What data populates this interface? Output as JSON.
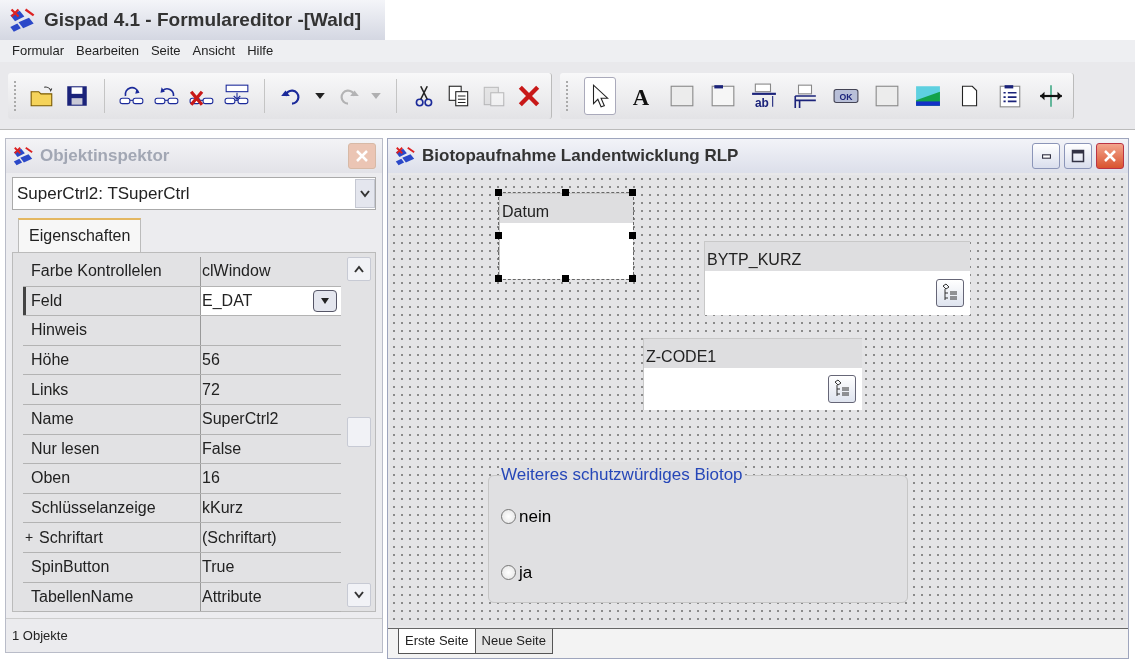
{
  "window": {
    "title": "Gispad 4.1 - Formulareditor -[Wald]"
  },
  "menu": [
    "Formular",
    "Bearbeiten",
    "Seite",
    "Ansicht",
    "Hilfe"
  ],
  "toolbar": [
    [
      {
        "kind": "open",
        "disabled": false
      },
      {
        "kind": "save",
        "disabled": false
      }
    ],
    [
      {
        "kind": "link-in",
        "disabled": false
      },
      {
        "kind": "link-out",
        "disabled": false
      },
      {
        "kind": "link-delete",
        "disabled": false
      },
      {
        "kind": "table-layout",
        "disabled": false
      }
    ],
    [
      {
        "kind": "undo",
        "disabled": false
      },
      {
        "kind": "dropdown",
        "disabled": false
      },
      {
        "kind": "redo",
        "disabled": true
      },
      {
        "kind": "dropdown",
        "disabled": true
      }
    ],
    [
      {
        "kind": "cut",
        "disabled": false
      },
      {
        "kind": "copy",
        "disabled": false
      },
      {
        "kind": "paste",
        "disabled": true
      },
      {
        "kind": "delete",
        "disabled": false
      }
    ]
  ],
  "tools": [
    {
      "kind": "pointer",
      "selected": true
    },
    {
      "kind": "text",
      "glyph": "A",
      "selected": false
    },
    {
      "kind": "blank",
      "selected": false
    },
    {
      "kind": "panel",
      "selected": false
    },
    {
      "kind": "edit",
      "glyph": "ab",
      "selected": false
    },
    {
      "kind": "grid",
      "selected": false
    },
    {
      "kind": "button",
      "glyph": "OK",
      "selected": false
    },
    {
      "kind": "blank",
      "selected": false
    },
    {
      "kind": "image",
      "selected": false
    },
    {
      "kind": "page",
      "selected": false
    },
    {
      "kind": "list",
      "selected": false
    },
    {
      "kind": "splitter",
      "selected": false
    }
  ],
  "inspector": {
    "title": "Objektinspektor",
    "object_select": "SuperCtrl2: TSuperCtrl",
    "tabs": [
      {
        "label": "Eigenschaften",
        "selected": true
      }
    ],
    "properties": [
      {
        "name": "Farbe Kontrollelen",
        "value": "clWindow",
        "selected": false
      },
      {
        "name": "Feld",
        "value": "E_DAT",
        "selected": true
      },
      {
        "name": "Hinweis",
        "selected": false
      },
      {
        "name": "Höhe",
        "value": "56",
        "selected": false
      },
      {
        "name": "Links",
        "value": "72",
        "selected": false
      },
      {
        "name": "Name",
        "value": "SuperCtrl2",
        "selected": false
      },
      {
        "name": "Nur lesen",
        "value": "False",
        "selected": false
      },
      {
        "name": "Oben",
        "value": "16",
        "selected": false
      },
      {
        "name": "Schlüsselanzeige",
        "value": "kKurz",
        "selected": false
      },
      {
        "name": "Schriftart",
        "expander": "+",
        "value": "(Schriftart)",
        "selected": false
      },
      {
        "name": "SpinButton",
        "value": "True",
        "selected": false
      },
      {
        "name": "TabellenName",
        "value": "Attribute",
        "selected": false
      }
    ],
    "status": "1 Objekte"
  },
  "form_window": {
    "title": "Biotopaufnahme Landentwicklung RLP",
    "controls": [
      {
        "kind": "field",
        "label": "Datum",
        "selected": true,
        "lookup_button": false
      },
      {
        "kind": "field",
        "label": "BYTP_KURZ",
        "selected": false,
        "lookup_button": true
      },
      {
        "kind": "field",
        "label": "Z-CODE1",
        "selected": false,
        "lookup_button": true
      },
      {
        "kind": "radiogroup",
        "caption": "Weiteres schutzwürdiges Biotop",
        "options": [
          {
            "label": "nein",
            "checked": false
          },
          {
            "label": "ja",
            "checked": false
          }
        ]
      }
    ],
    "page_tabs": [
      {
        "label": "Erste Seite",
        "selected": true
      },
      {
        "label": "Neue Seite",
        "selected": false
      }
    ]
  }
}
